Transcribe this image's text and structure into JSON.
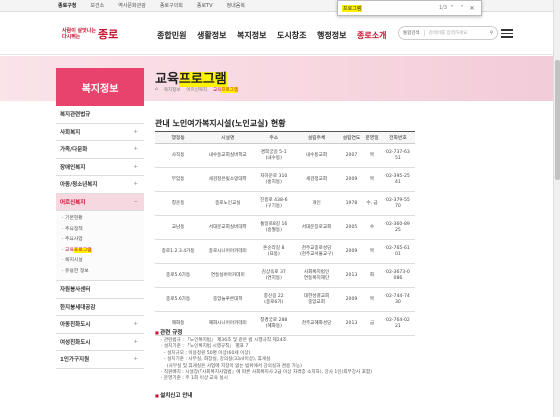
{
  "topbar": {
    "links": [
      "종로구청",
      "보건소",
      "역사문화관광",
      "종로구의회",
      "종로TV",
      "정내음복"
    ]
  },
  "find": {
    "query": "프로그램",
    "count": "1/3"
  },
  "header": {
    "logo_small": "사람이 살맛나는\n다시뛰는",
    "logo_big": "종로",
    "menu": [
      "종합민원",
      "생활정보",
      "복지정보",
      "도시창조",
      "행정정보",
      "종로소개"
    ],
    "search_select": "통합검색",
    "search_placeholder": "검색어를 입력하세요"
  },
  "lnb": {
    "title": "복지정보",
    "items": [
      {
        "label": "복지관련법규",
        "plus": ""
      },
      {
        "label": "사회복지",
        "plus": "+"
      },
      {
        "label": "가족/다문화",
        "plus": "+"
      },
      {
        "label": "장애인복지",
        "plus": "+"
      },
      {
        "label": "아동/청소년복지",
        "plus": "+"
      },
      {
        "label": "어르신복지",
        "plus": "−"
      }
    ],
    "sub": [
      "· 기본현황",
      "· 주요정책",
      "· 주요사업",
      "· 교육",
      "프로그램",
      "· 복지시설",
      "· 유용한 정보"
    ],
    "items2": [
      {
        "label": "자원봉사센터",
        "plus": ""
      },
      {
        "label": "한지붕세대공감",
        "plus": ""
      },
      {
        "label": "아동친화도시",
        "plus": "+"
      },
      {
        "label": "여성친화도시",
        "plus": "+"
      },
      {
        "label": "1인가구지원",
        "plus": "+"
      }
    ]
  },
  "page": {
    "title_pre": "교육",
    "title_hl": "프로그램",
    "breadcrumb": [
      "⌂",
      "복지정보",
      "어르신복지",
      "교육",
      "프로그램"
    ],
    "section_title": "관내 노인여가복지시설(노인교실) 현황"
  },
  "table": {
    "headers": [
      "행정동",
      "시설명",
      "주소",
      "설립주체",
      "설립연도",
      "운영일",
      "전화번호"
    ],
    "rows": [
      [
        "사직동",
        "내수동교회실버학교",
        "경희궁길 5-1\n(내수동)",
        "내수동교회",
        "2007",
        "목",
        "02-737-63\n51"
      ],
      [
        "부암동",
        "세검정은빛소망대학",
        "자하문로 310\n(홍지동)",
        "세검정교회",
        "2009",
        "목",
        "02-395-25\n41"
      ],
      [
        "청운동",
        "종로노인교실",
        "진흥로 438-6\n(구기동)",
        "개인",
        "1978",
        "수, 금",
        "02-379-55\n70"
      ],
      [
        "교남동",
        "서대문교회실버대학",
        "통일로8길 16\n(송월동)",
        "서대문장로교회",
        "2005",
        "수",
        "02-360-89\n25"
      ],
      [
        "종로1.2.3.4가동",
        "종로시니어아카데미",
        "돈순라길 8\n(묘동)",
        "천주교종로성당\n(천주교서울교구)",
        "2009",
        "목",
        "02-765-61\n01"
      ],
      [
        "종로5.6가동",
        "연동실버아카데미",
        "김상옥로 37\n(연지동)",
        "사회복지법인\n연동복지재단",
        "2013",
        "화",
        "02-3673-0\n086"
      ],
      [
        "종로5.6가동",
        "중앙늘푸른대학",
        "충신길 22\n(종로6가)",
        "대한성결교회\n중앙교회",
        "2009",
        "목",
        "02-744-74\n30"
      ],
      [
        "혜화동",
        "혜화시니어아카데미",
        "창경궁로 288\n(혜화동)",
        "천주교혜화성당",
        "2013",
        "금",
        "02-764-02\n21"
      ]
    ]
  },
  "notes": {
    "head1": "관련 규정",
    "lines": [
      "· 관련법규 : 「노인복지법」 제36조 및 같은 법 시행규칙 제24조",
      "· 설치기준 : 「노인복지법 시행규칙」 별표 7",
      "  - 설치규모 : 이용정원 50명 이상(60세 이상)",
      "  - 설치기준 : 사무실, 화장실, 강의실(33㎡이상), 휴게실",
      "    (사무실 및 휴게실은 사업에 지장이 없는 범위에서 강의실과 겸용 가능)",
      "· 직원배치 : 시설장(「사회복지사업법」에 따른 사회복지사 2급 이상 자격증 소지자), 강사 1인(외부강사 포함)",
      "· 운영기준 : 주 1회 이상 교육 실시"
    ],
    "head2": "설치신고 안내"
  },
  "colors": {
    "brand": "#c8102e",
    "lnb_head": "#e8436d",
    "highlight": "#fff200"
  }
}
